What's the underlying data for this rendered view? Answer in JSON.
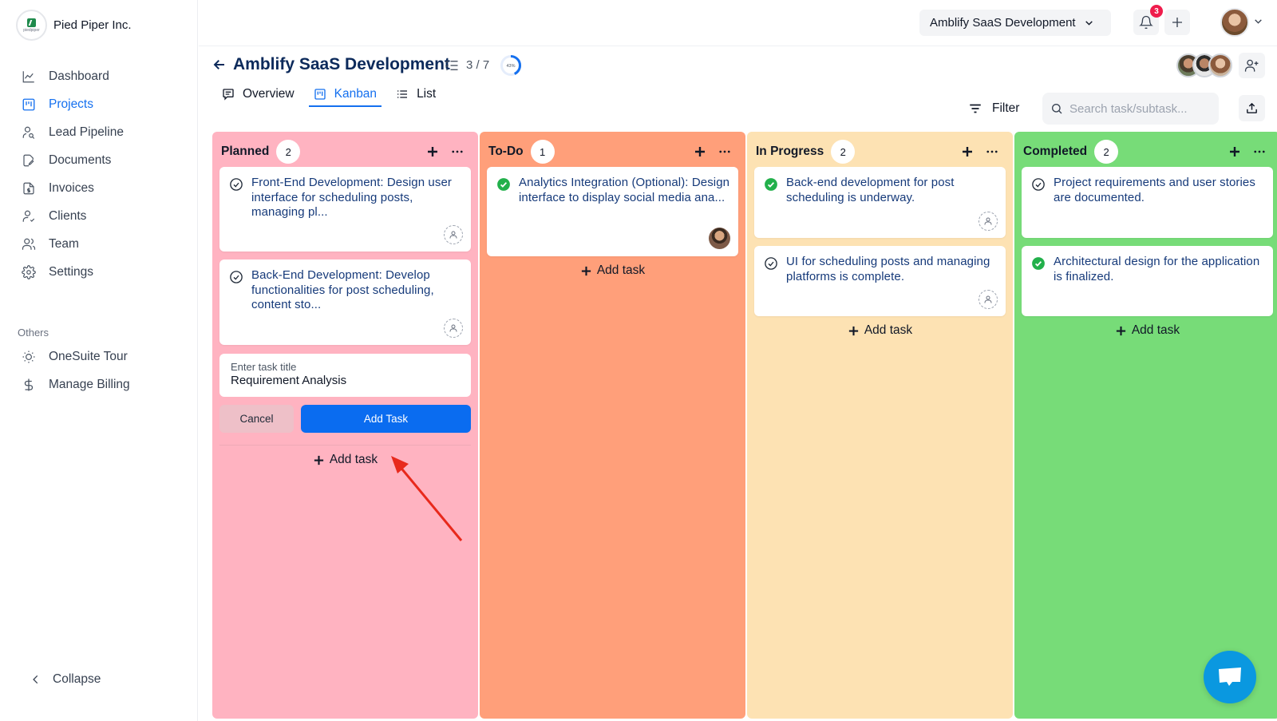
{
  "brand": {
    "name": "Pied Piper Inc.",
    "logo_word": "piedpiper"
  },
  "sidebar": {
    "items": [
      {
        "label": "Dashboard",
        "icon": "chart-line-icon",
        "active": false
      },
      {
        "label": "Projects",
        "icon": "kanban-icon",
        "active": true
      },
      {
        "label": "Lead Pipeline",
        "icon": "user-search-icon",
        "active": false
      },
      {
        "label": "Documents",
        "icon": "document-edit-icon",
        "active": false
      },
      {
        "label": "Invoices",
        "icon": "invoice-icon",
        "active": false
      },
      {
        "label": "Clients",
        "icon": "user-check-icon",
        "active": false
      },
      {
        "label": "Team",
        "icon": "users-icon",
        "active": false
      },
      {
        "label": "Settings",
        "icon": "gear-icon",
        "active": false
      }
    ],
    "others_label": "Others",
    "others": [
      {
        "label": "OneSuite Tour",
        "icon": "sun-icon"
      },
      {
        "label": "Manage Billing",
        "icon": "dollar-icon"
      }
    ],
    "collapse_label": "Collapse"
  },
  "topbar": {
    "project_selector": "Amblify SaaS Development",
    "notification_count": "3"
  },
  "header": {
    "title": "Amblify SaaS Development",
    "task_count": "3 / 7",
    "progress_label": "43%",
    "progress_value": 0.43,
    "tabs": [
      {
        "label": "Overview",
        "icon": "message-square-icon",
        "active": false
      },
      {
        "label": "Kanban",
        "icon": "kanban-icon",
        "active": true
      },
      {
        "label": "List",
        "icon": "list-icon",
        "active": false
      }
    ],
    "filter_label": "Filter",
    "search_placeholder": "Search task/subtask..."
  },
  "colors": {
    "accent": "#1570ef",
    "planned": "#ffb3c1",
    "todo": "#ff9f7a",
    "in_progress": "#fde2b3",
    "completed": "#77dc78"
  },
  "columns": [
    {
      "title": "Planned",
      "count": "2",
      "cards": [
        {
          "text": "Front-End Development: Design user interface for scheduling posts, managing pl...",
          "done": false,
          "assignee": "unassigned"
        },
        {
          "text": "Back-End Development: Develop functionalities for post scheduling, content sto...",
          "done": false,
          "assignee": "unassigned"
        }
      ],
      "new_task": {
        "label": "Enter task title",
        "value": "Requirement Analysis",
        "cancel": "Cancel",
        "submit": "Add Task"
      },
      "add_task": "Add task"
    },
    {
      "title": "To-Do",
      "count": "1",
      "cards": [
        {
          "text": "Analytics Integration (Optional): Design interface to display social media ana...",
          "done": true,
          "assignee": "avatar"
        }
      ],
      "add_task": "Add task"
    },
    {
      "title": "In Progress",
      "count": "2",
      "cards": [
        {
          "text": "Back-end development for post scheduling is underway.",
          "done": true,
          "assignee": "unassigned"
        },
        {
          "text": "UI for scheduling posts and managing platforms is complete.",
          "done": false,
          "assignee": "unassigned"
        }
      ],
      "add_task": "Add task"
    },
    {
      "title": "Completed",
      "count": "2",
      "cards": [
        {
          "text": "Project requirements and user stories are documented.",
          "done": false,
          "assignee": "none"
        },
        {
          "text": "Architectural design for the application is finalized.",
          "done": true,
          "assignee": "none"
        }
      ],
      "add_task": "Add task"
    }
  ]
}
